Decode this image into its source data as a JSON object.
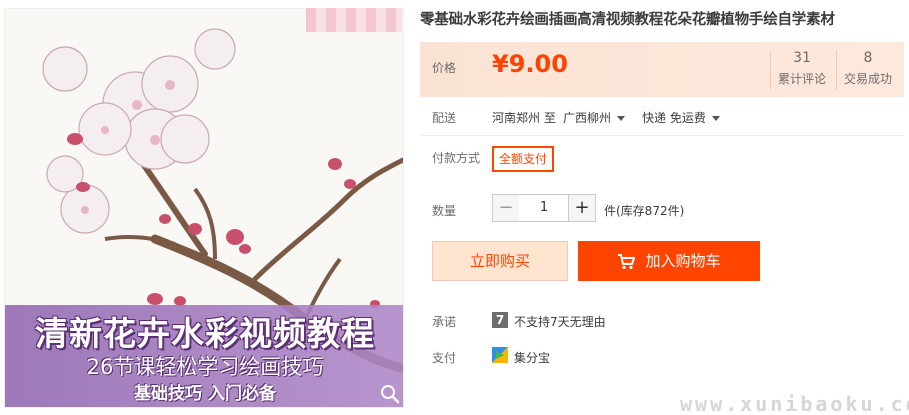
{
  "product": {
    "title": "零基础水彩花卉绘画插画高清视频教程花朵花瓣植物手绘自学素材",
    "image": {
      "banner_title": "清新花卉水彩视频教程",
      "banner_subtitle": "26节课轻松学习绘画技巧",
      "banner_tagline": "基础技巧 入门必备"
    }
  },
  "price_box": {
    "label": "价格",
    "price": "¥9.00",
    "reviews": {
      "count": "31",
      "label": "累计评论"
    },
    "sales": {
      "count": "8",
      "label": "交易成功"
    },
    "colors": {
      "price": "#ff4400",
      "background": "#fbe3d4"
    }
  },
  "shipping": {
    "label": "配送",
    "from": "河南郑州 至",
    "to": "广西柳州",
    "method": "快递 免运费"
  },
  "payment_method": {
    "label": "付款方式",
    "selected": "全额支付"
  },
  "quantity": {
    "label": "数量",
    "value": "1",
    "minus": "−",
    "plus": "+",
    "stock": "件(库存872件)"
  },
  "actions": {
    "buy_now": "立即购买",
    "add_to_cart": "加入购物车"
  },
  "promise": {
    "label": "承诺",
    "icon_text": "7",
    "text": "不支持7天无理由"
  },
  "pay": {
    "label": "支付",
    "text": "集分宝"
  },
  "watermark": "www.xunibaoku.com"
}
